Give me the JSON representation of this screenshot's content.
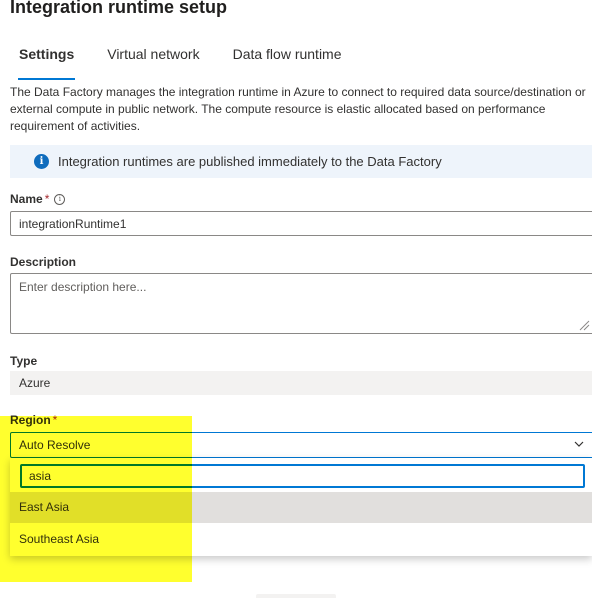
{
  "page": {
    "title": "Integration runtime setup"
  },
  "tabs": [
    {
      "label": "Settings",
      "active": true
    },
    {
      "label": "Virtual network",
      "active": false
    },
    {
      "label": "Data flow runtime",
      "active": false
    }
  ],
  "description_text": "The Data Factory manages the integration runtime in Azure to connect to required data source/destination or external compute in public network. The compute resource is elastic allocated based on performance requirement of activities.",
  "info_bar": {
    "icon": "info-icon",
    "text": "Integration runtimes are published immediately to the Data Factory"
  },
  "form": {
    "name": {
      "label": "Name",
      "required_mark": "*",
      "info_icon": "info-small-icon",
      "value": "integrationRuntime1"
    },
    "description": {
      "label": "Description",
      "placeholder": "Enter description here..."
    },
    "type": {
      "label": "Type",
      "value": "Azure"
    },
    "region": {
      "label": "Region",
      "required_mark": "*",
      "selected": "Auto Resolve",
      "search_value": "asia",
      "options": [
        {
          "label": "East Asia",
          "hovered": true
        },
        {
          "label": "Southeast Asia",
          "hovered": false
        }
      ]
    }
  },
  "colors": {
    "accent": "#0078d4",
    "info_bar_bg": "#eef4fb",
    "highlight": "#ffff00",
    "required": "#a4262c"
  }
}
